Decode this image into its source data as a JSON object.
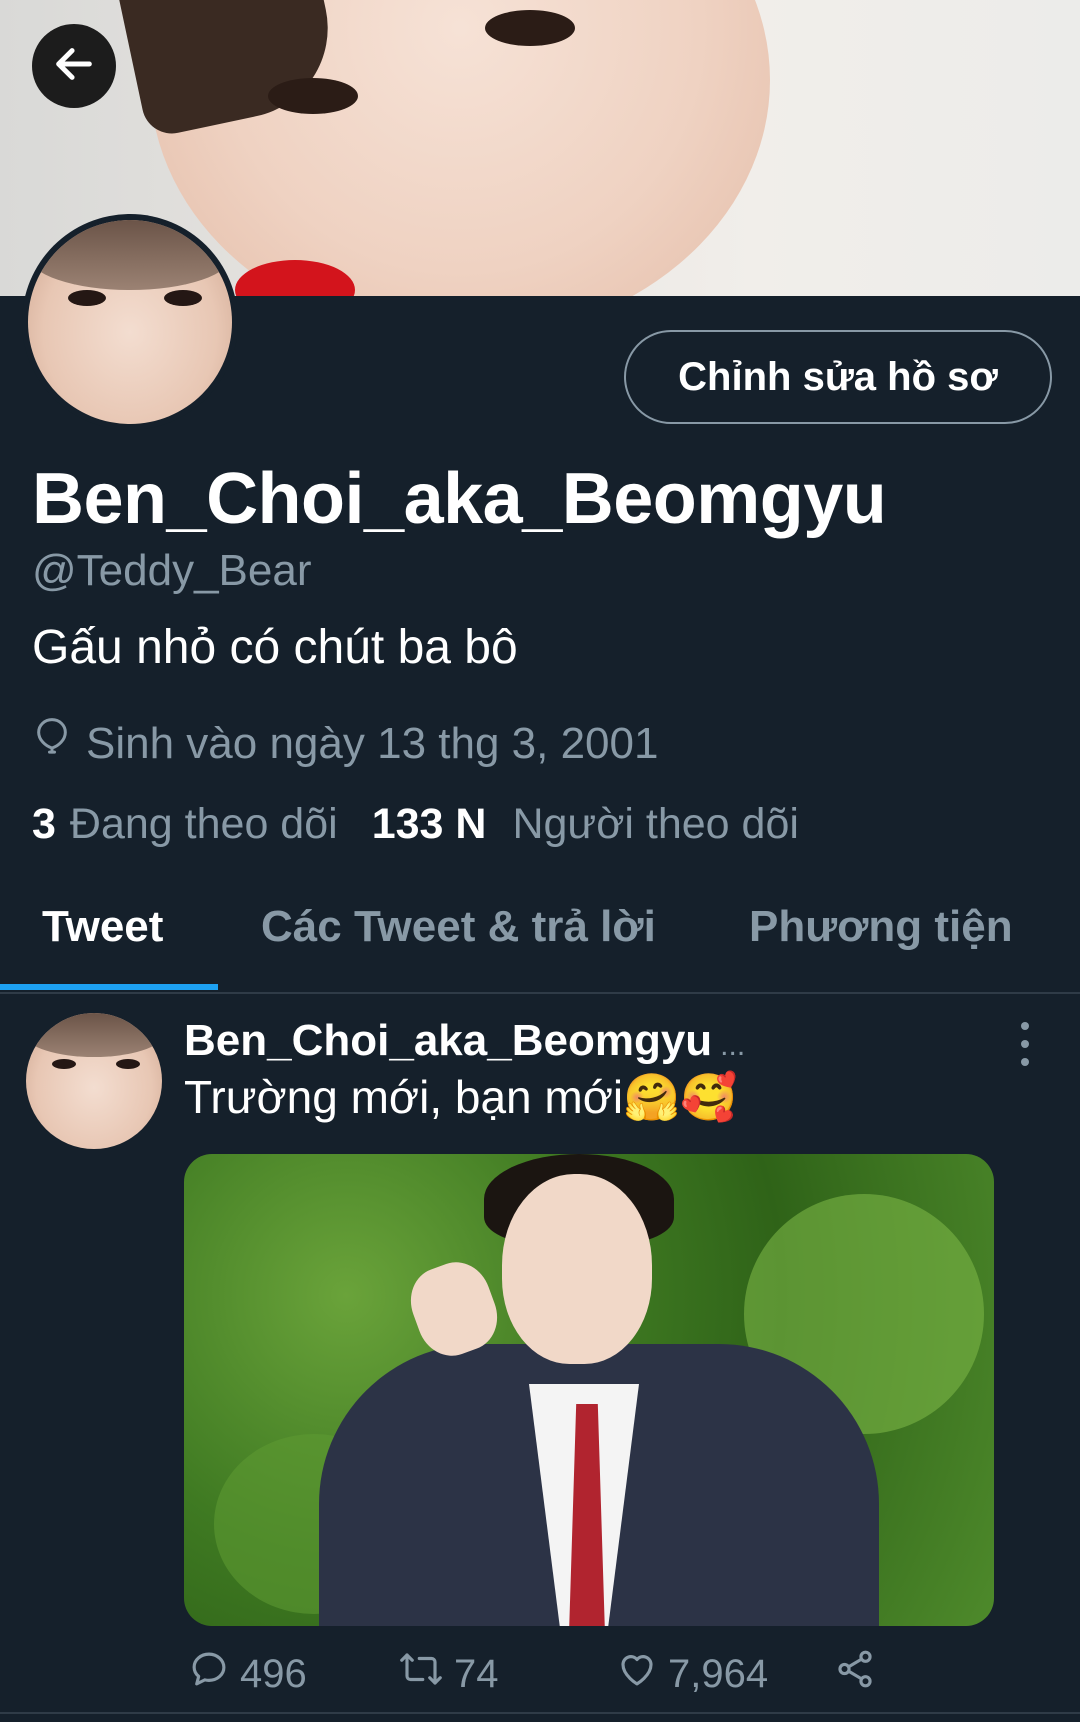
{
  "profile": {
    "edit_button_label": "Chỉnh sửa hồ sơ",
    "display_name": "Ben_Choi_aka_Beomgyu",
    "handle": "@Teddy_Bear",
    "bio": "Gấu nhỏ có chút ba bô",
    "birthday": "Sinh vào ngày 13 thg 3, 2001",
    "following_count": "3",
    "following_label": "Đang theo dõi",
    "followers_count": "133 N",
    "followers_label": "Người theo dõi"
  },
  "tabs": [
    {
      "label": "Tweet",
      "active": true
    },
    {
      "label": "Các Tweet & trả lời",
      "active": false
    },
    {
      "label": "Phương tiện",
      "active": false
    }
  ],
  "tweet": {
    "author": "Ben_Choi_aka_Beomgyu",
    "author_more": "...",
    "text": "Trường mới, bạn mới🤗🥰",
    "replies": "496",
    "retweets": "74",
    "likes": "7,964"
  },
  "icons": {
    "back": "arrow-left-icon",
    "birthday": "balloon-icon",
    "menu": "more-vertical-icon",
    "reply": "reply-icon",
    "retweet": "retweet-icon",
    "like": "heart-icon",
    "share": "share-icon"
  },
  "colors": {
    "background": "#15202b",
    "secondary_text": "#8899a6",
    "accent": "#1da1f2"
  }
}
